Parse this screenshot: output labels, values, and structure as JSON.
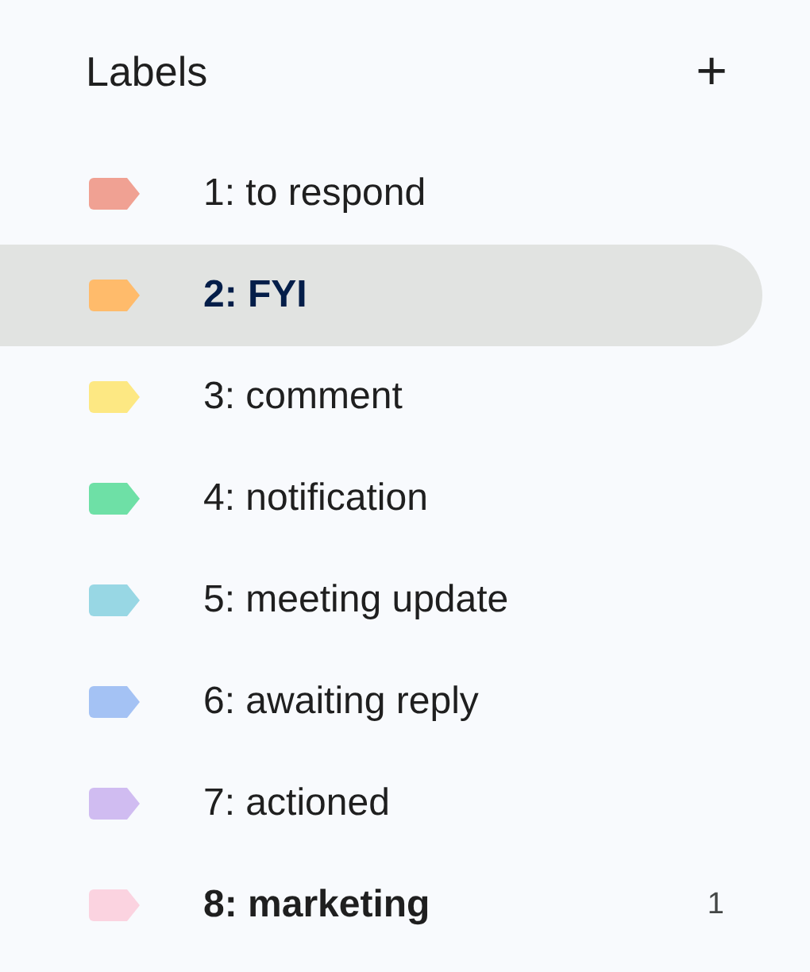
{
  "header": {
    "title": "Labels",
    "add_icon": "+"
  },
  "labels": [
    {
      "name": "1: to respond",
      "color": "#f0a193",
      "selected": false,
      "bold": false
    },
    {
      "name": "2: FYI",
      "color": "#ffbb6b",
      "selected": true,
      "bold": true
    },
    {
      "name": "3: comment",
      "color": "#fde883",
      "selected": false,
      "bold": false
    },
    {
      "name": "4: notification",
      "color": "#6ee0a6",
      "selected": false,
      "bold": false
    },
    {
      "name": "5: meeting update",
      "color": "#98d7e4",
      "selected": false,
      "bold": false
    },
    {
      "name": "6: awaiting reply",
      "color": "#a4c2f4",
      "selected": false,
      "bold": false
    },
    {
      "name": "7: actioned",
      "color": "#d0bcf1",
      "selected": false,
      "bold": false
    },
    {
      "name": "8: marketing",
      "color": "#fbd3e0",
      "selected": false,
      "bold": true,
      "count": "1"
    }
  ]
}
